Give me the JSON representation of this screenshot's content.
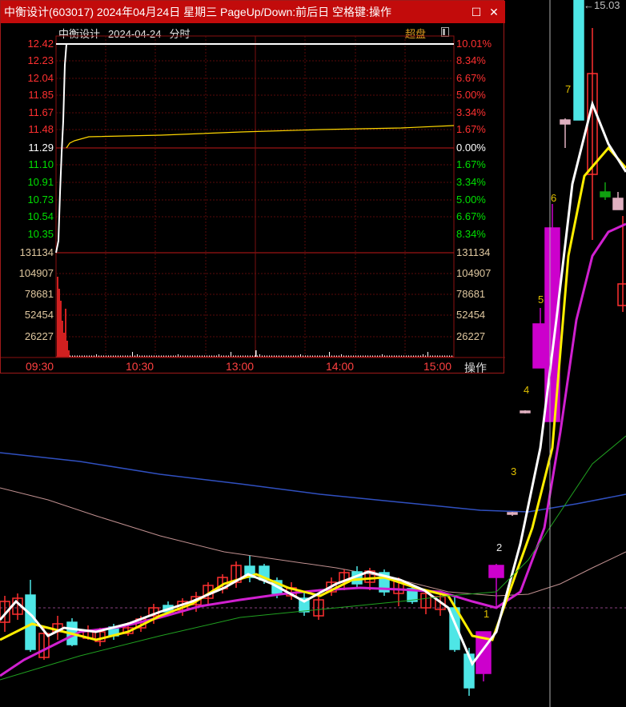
{
  "window": {
    "title": "中衡设计(603017) 2024年04月24日 星期三 PageUp/Down:前后日 空格键:操作",
    "minimize_icon": "maximize-icon",
    "close_icon": "close-icon"
  },
  "info": {
    "stock_name": "中衡设计",
    "date": "2024-04-24",
    "mode": "分时"
  },
  "chaopan_label": "超盘",
  "price_axis_left": [
    "12.42",
    "12.23",
    "12.04",
    "11.85",
    "11.67",
    "11.48",
    "11.29",
    "11.10",
    "10.91",
    "10.73",
    "10.54",
    "10.35"
  ],
  "pct_axis_right": [
    "10.01%",
    "8.34%",
    "6.67%",
    "5.00%",
    "3.34%",
    "1.67%",
    "0.00%",
    "1.67%",
    "3.34%",
    "5.00%",
    "6.67%",
    "8.34%"
  ],
  "volume_axis": [
    "131134",
    "104907",
    "78681",
    "52454",
    "26227"
  ],
  "time_axis": [
    "09:30",
    "10:30",
    "13:00",
    "14:00",
    "15:00"
  ],
  "ops_label": "操作",
  "background_chart": {
    "high_label": "15.03",
    "wave_labels": [
      "1",
      "2",
      "3",
      "4",
      "5",
      "6",
      "7"
    ]
  },
  "colors": {
    "up": "#ff3030",
    "down": "#4ee6e6",
    "limit": "#cc00cc",
    "ma5": "#ffffff",
    "ma10": "#ffee00",
    "ma20": "#cc33cc",
    "titlebar": "#c20b0b"
  }
}
